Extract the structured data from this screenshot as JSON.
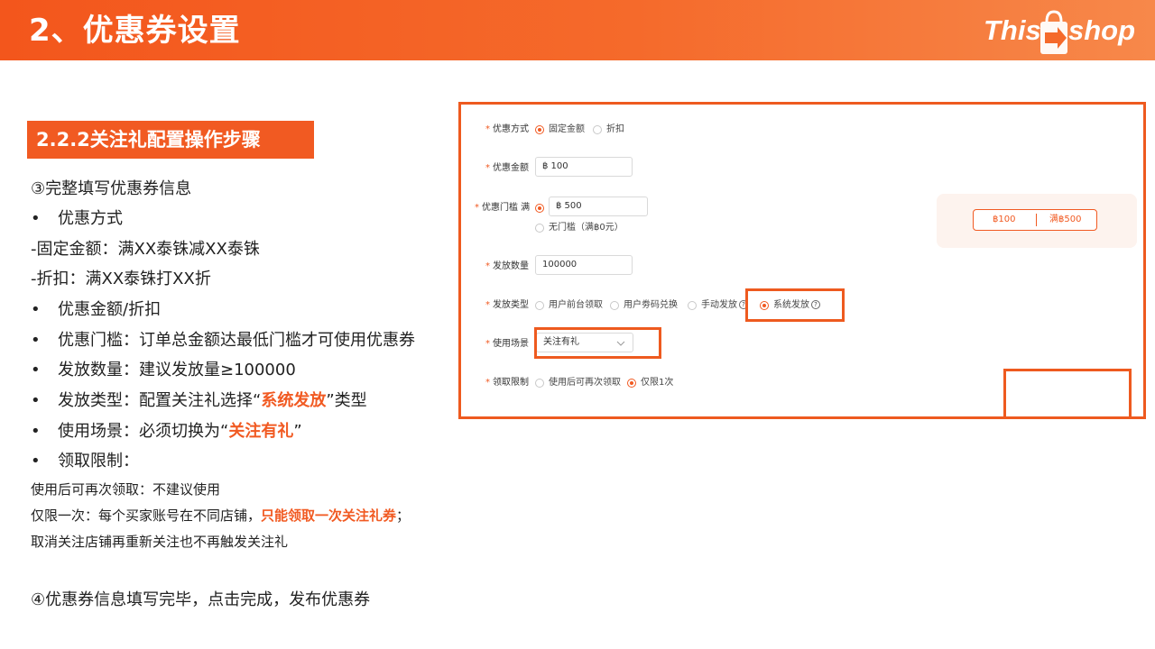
{
  "header": {
    "title": "2、优惠券设置",
    "logo_left": "This",
    "logo_right": "shop",
    "color": "#f3561c"
  },
  "section": {
    "title": "2.2.2关注礼配置操作步骤"
  },
  "content": {
    "step3": "③完整填写优惠券信息",
    "bullet_char": "•",
    "b1": "优惠方式",
    "sub1": "-固定金额：满XX泰铢减XX泰铢",
    "sub2": "-折扣：满XX泰铢打XX折",
    "b2": "优惠金额/折扣",
    "b3": "优惠门槛：订单总金额达最低门槛才可使用优惠券",
    "b4": "发放数量：建议发放量≥100000",
    "b5_pre": "发放类型：配置关注礼选择“",
    "b5_hl": "系统发放",
    "b5_post": "”类型",
    "b6_pre": "使用场景：必须切换为“",
    "b6_hl": "关注有礼",
    "b6_post": "”",
    "b7": "领取限制：",
    "note1": "使用后可再次领取：不建议使用",
    "note2_pre": "仅限一次：每个买家账号在不同店铺，",
    "note2_hl": "只能领取一次关注礼券",
    "note2_post": "；",
    "note3": "取消关注店铺再重新关注也不再触发关注礼",
    "step4": "④优惠券信息填写完毕，点击完成，发布优惠券",
    "highlight_color": "#f15a22"
  },
  "form": {
    "required_mark": "*",
    "discount_type": {
      "label": "优惠方式",
      "options": [
        "固定金额",
        "折扣"
      ],
      "selected": "固定金额"
    },
    "discount_amount": {
      "label": "优惠金额",
      "value": "฿ 100"
    },
    "threshold": {
      "label": "优惠门槛 满",
      "value": "฿ 500",
      "no_threshold": "无门槛（满฿0元）"
    },
    "quantity": {
      "label": "发放数量",
      "value": "100000"
    },
    "issue_type": {
      "label": "发放类型",
      "options": [
        "用户前台领取",
        "用户劵码兑换",
        "手动发放",
        "系统发放"
      ],
      "selected": "系统发放",
      "help": "?"
    },
    "scene": {
      "label": "使用场景",
      "value": "关注有礼"
    },
    "limit": {
      "label": "领取限制",
      "options": [
        "使用后可再次领取",
        "仅限1次"
      ],
      "selected": "仅限1次"
    },
    "preview": {
      "amount": "฿100",
      "condition": "满฿500"
    }
  }
}
